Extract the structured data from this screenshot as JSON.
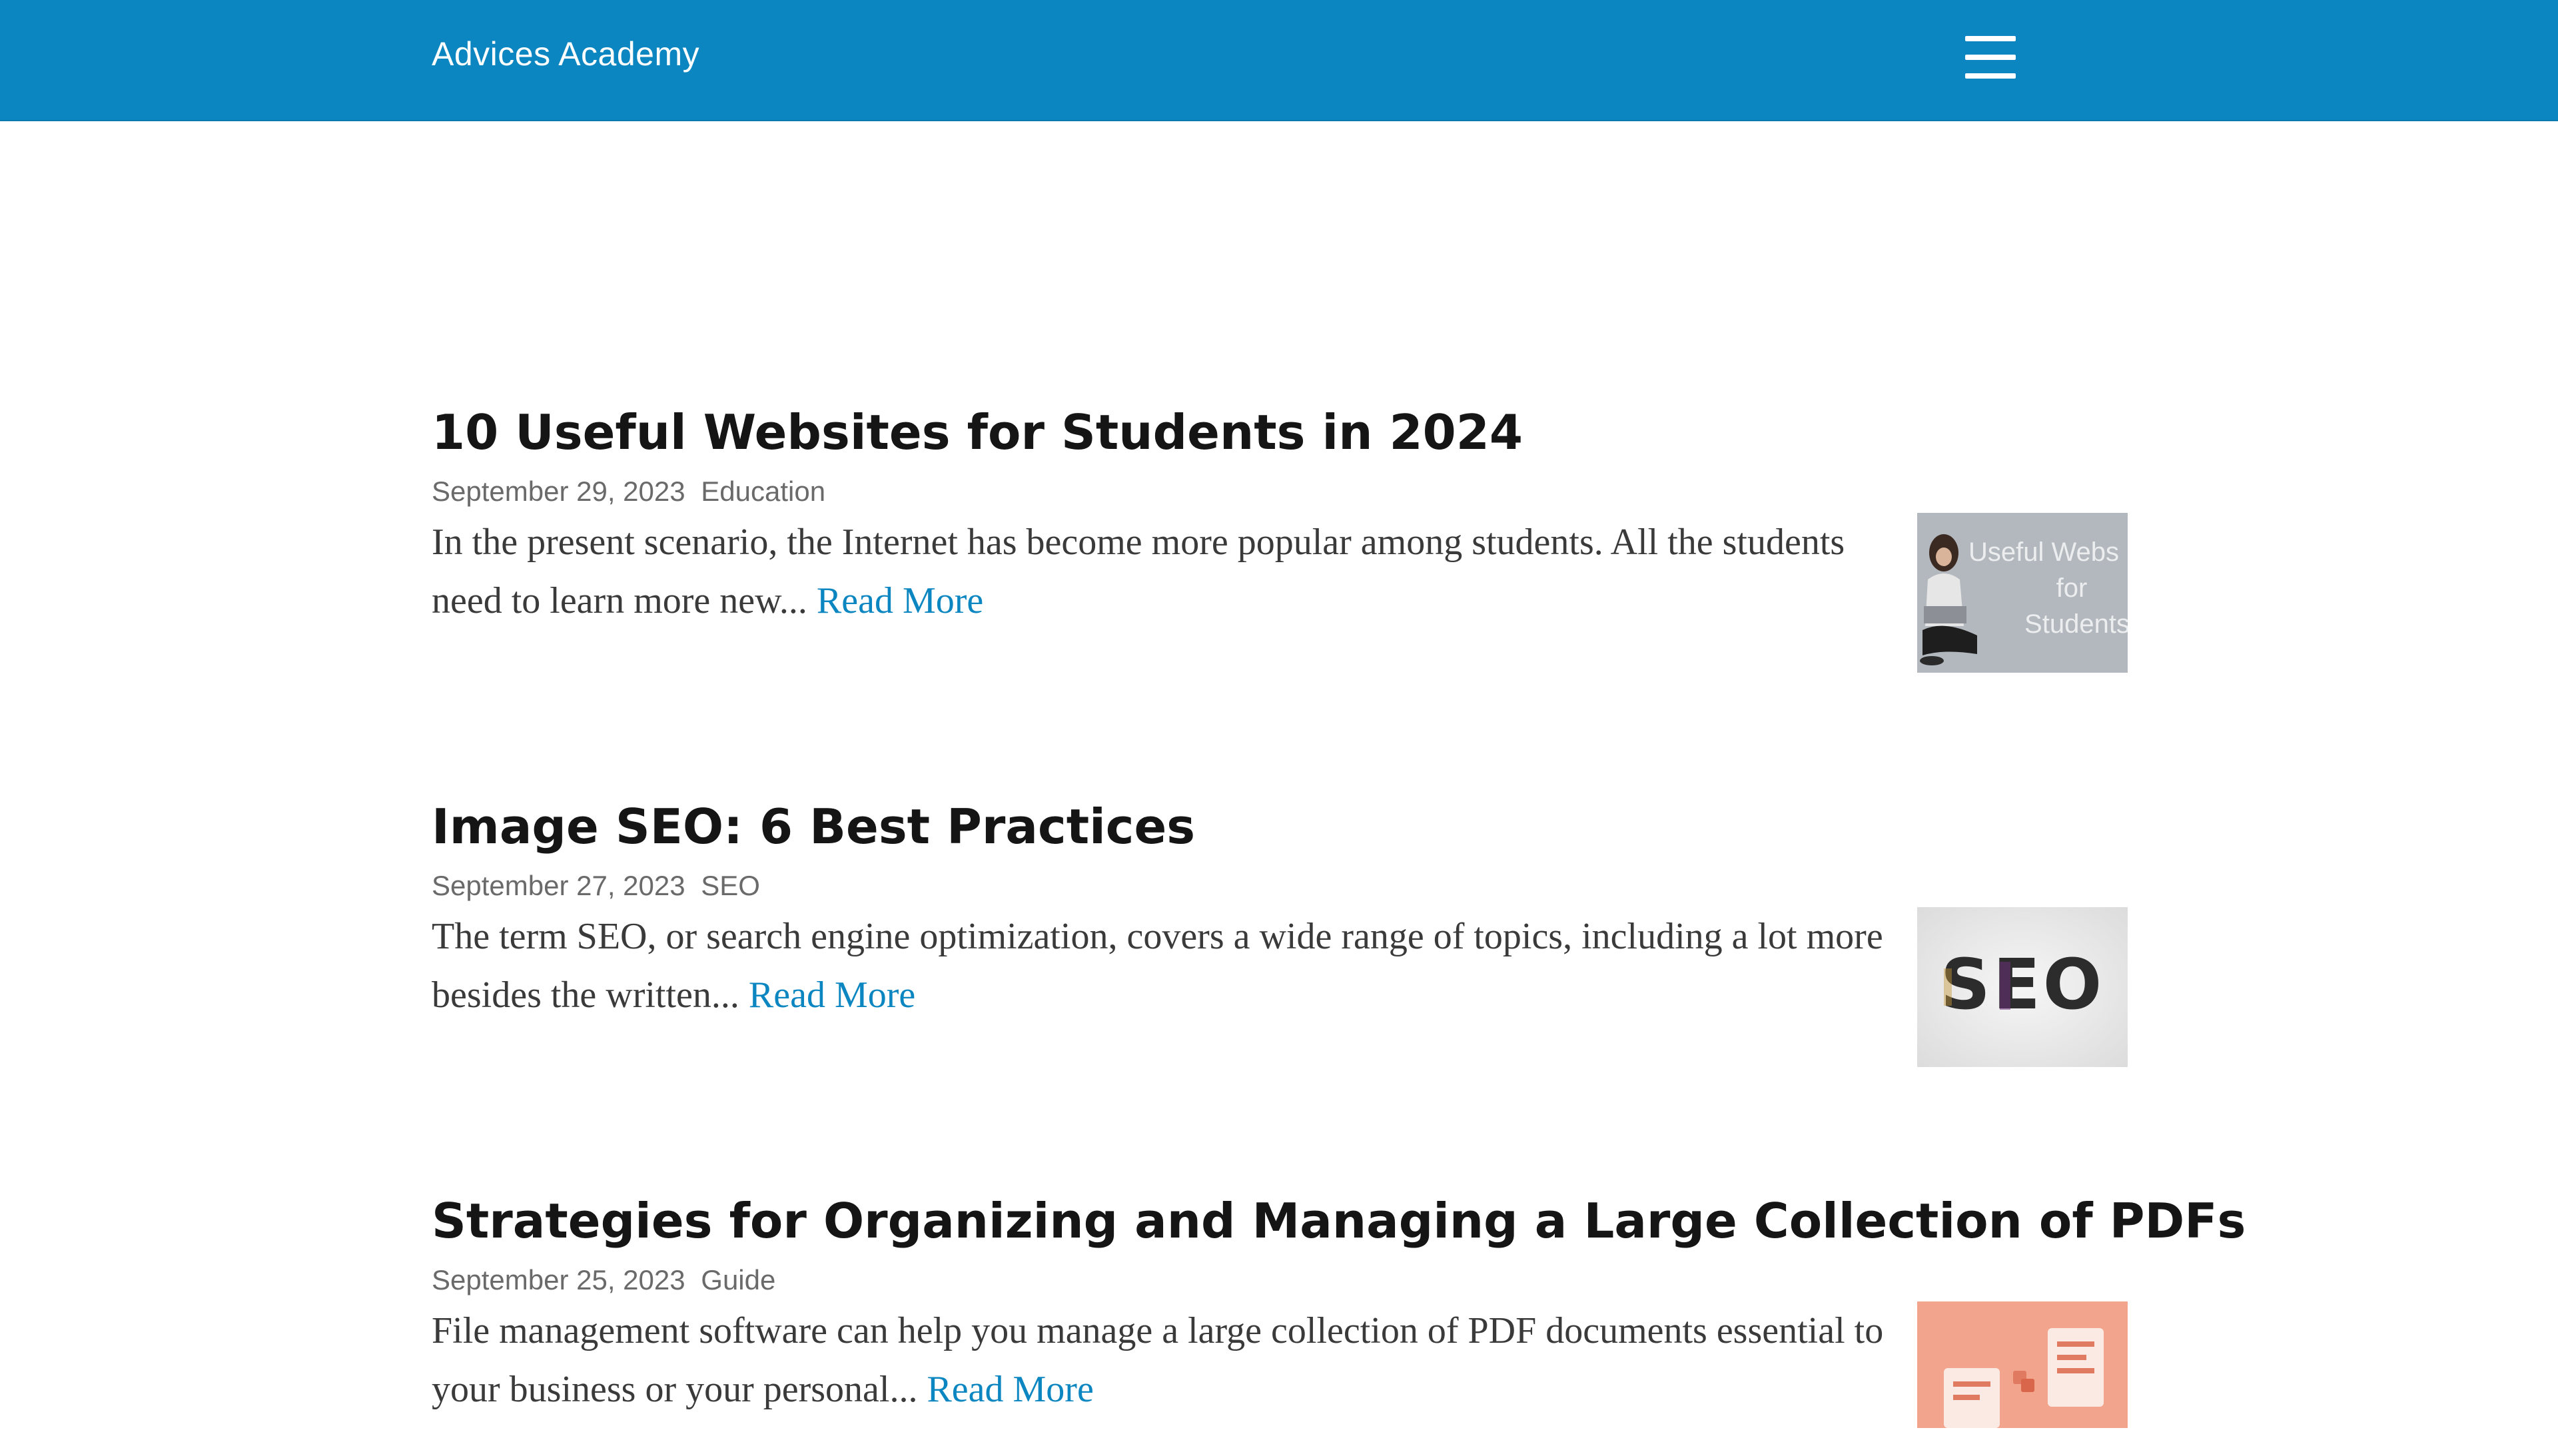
{
  "header": {
    "brand": "Advices Academy",
    "menu_icon": "hamburger-menu-icon",
    "background_color": "#0b86c1"
  },
  "posts": [
    {
      "title": "10 Useful Websites for Students in 2024",
      "date": "September 29, 2023",
      "category": "Education",
      "excerpt": "In the present scenario, the Internet has become more popular among students. All the students need to learn more new...",
      "read_more": "Read More",
      "thumbnail_text": [
        "Useful Webs",
        "for",
        "Students"
      ]
    },
    {
      "title": "Image SEO: 6 Best Practices",
      "date": "September 27, 2023",
      "category": "SEO",
      "excerpt": "The term SEO, or search engine optimization, covers a wide range of topics, including a lot more besides the written...",
      "read_more": "Read More",
      "thumbnail_text": [
        "SEO"
      ]
    },
    {
      "title": "Strategies for Organizing and Managing a Large Collection of PDFs",
      "date": "September 25, 2023",
      "category": "Guide",
      "excerpt": "File management software can help you manage a large collection of PDF documents essential to your business or your personal...",
      "read_more": "Read More",
      "thumbnail_text": []
    }
  ],
  "colors": {
    "link": "#0b86c1",
    "title": "#151515",
    "meta": "#6a6a6a",
    "body": "#3a3a3a"
  }
}
